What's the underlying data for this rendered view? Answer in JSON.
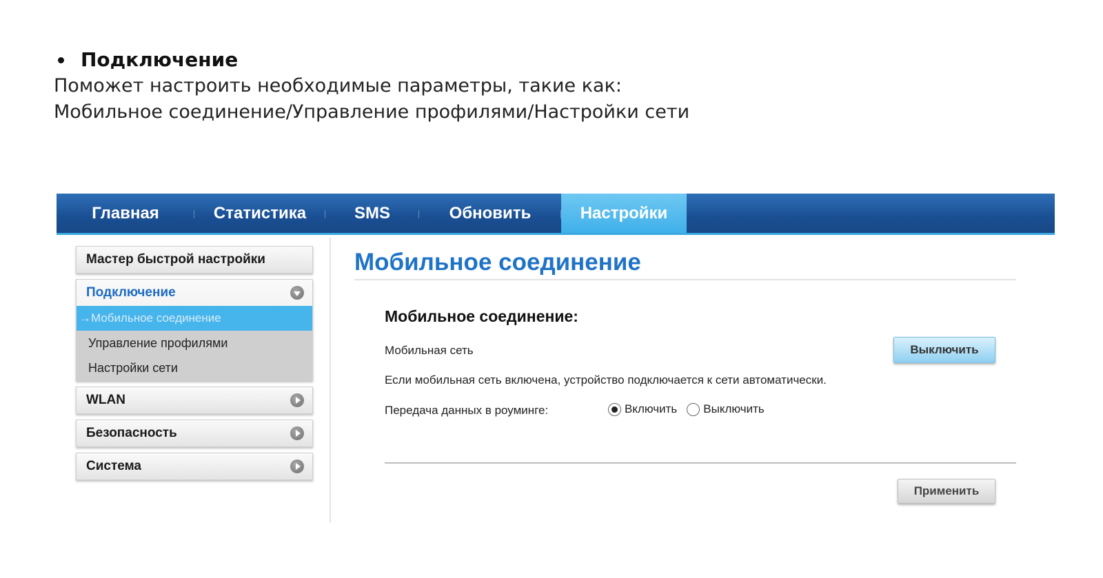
{
  "intro": {
    "title": "Подключение",
    "line1": "Поможет настроить необходимые параметры, такие как:",
    "line2": "Мобильное соединение/Управление профилями/Настройки сети"
  },
  "nav": {
    "tabs": [
      {
        "label": "Главная"
      },
      {
        "label": "Статистика"
      },
      {
        "label": "SMS"
      },
      {
        "label": "Обновить"
      },
      {
        "label": "Настройки",
        "active": true
      }
    ]
  },
  "sidebar": {
    "quick_setup": "Мастер быстрой настройки",
    "connection": {
      "label": "Подключение",
      "items": [
        {
          "label": "→Мобильное соединение",
          "active": true
        },
        {
          "label": "Управление профилями"
        },
        {
          "label": "Настройки сети"
        }
      ]
    },
    "wlan": "WLAN",
    "security": "Безопасность",
    "system": "Система"
  },
  "main": {
    "title": "Мобильное соединение",
    "section_title": "Мобильное соединение:",
    "mobile_network_label": "Мобильная сеть",
    "toggle_button": "Выключить",
    "info_text": "Если мобильная сеть включена, устройство подключается к сети автоматически.",
    "roaming_label": "Передача данных в роуминге:",
    "roaming_on": "Включить",
    "roaming_off": "Выключить",
    "roaming_selected": "Включить",
    "apply_button": "Применить"
  },
  "colors": {
    "nav_blue": "#1a4f93",
    "nav_active": "#46b5ec",
    "title_blue": "#1f73c7",
    "link_blue": "#1d6bc2"
  }
}
